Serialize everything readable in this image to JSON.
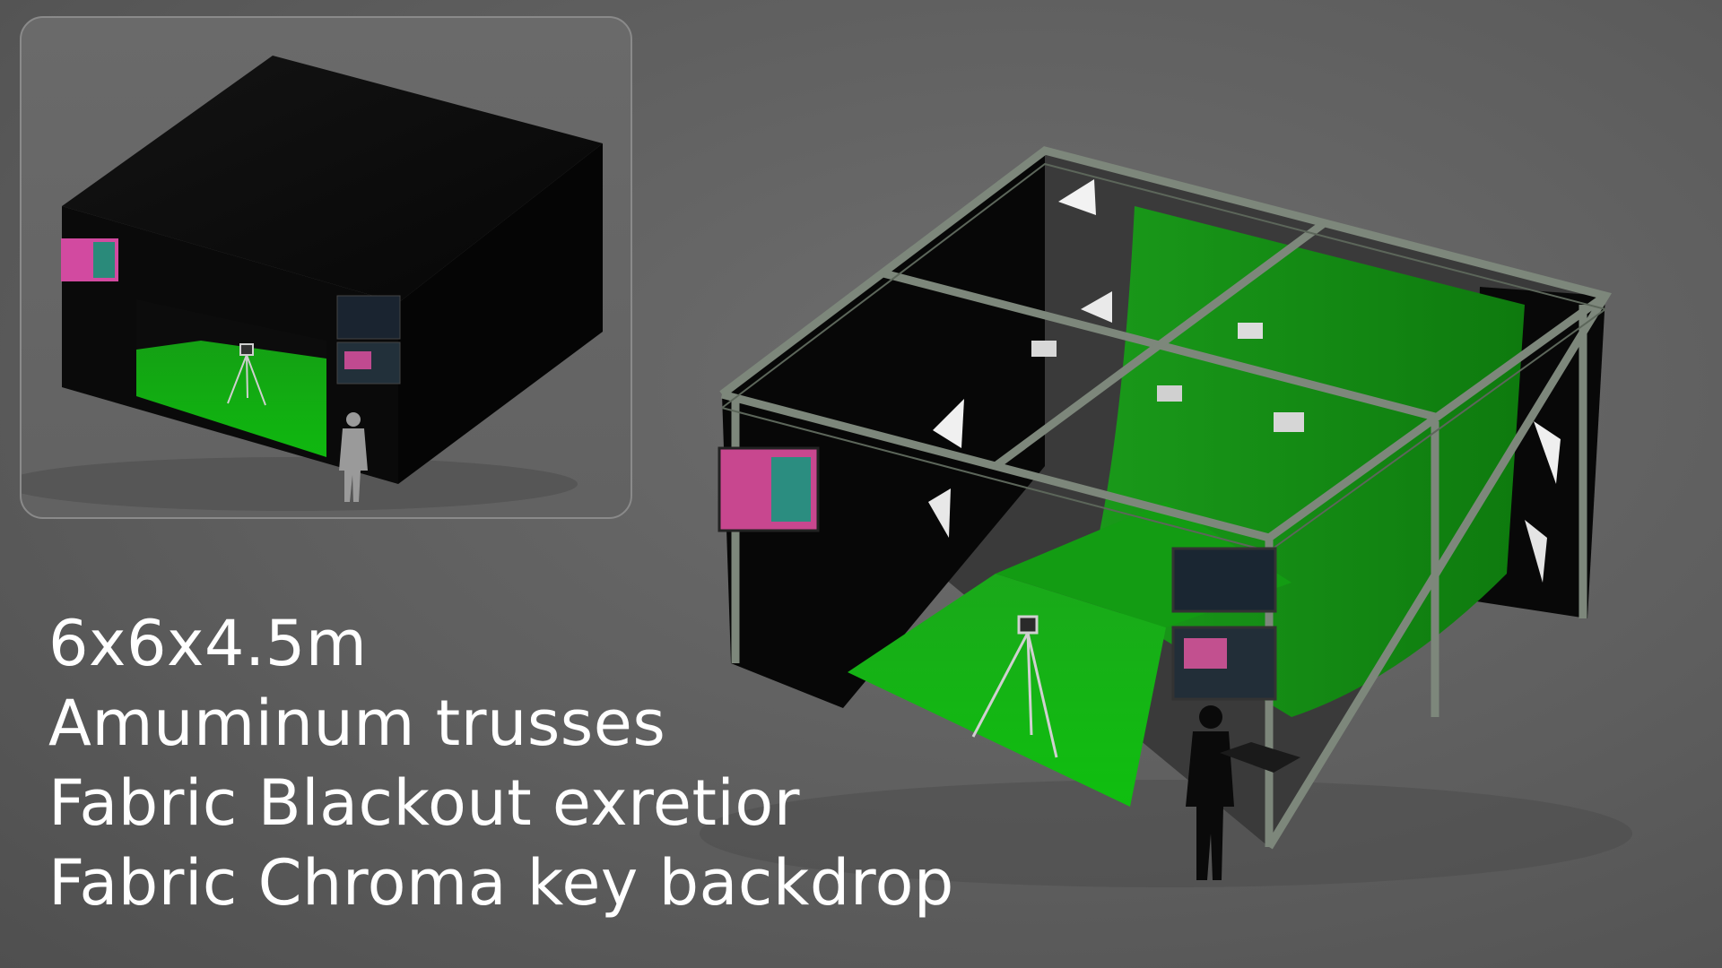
{
  "specs": {
    "line1": "6x6x4.5m",
    "line2": "Amuminum trusses",
    "line3": "Fabric Blackout exretior",
    "line4": "Fabric Chroma key backdrop"
  },
  "colors": {
    "background": "#5f5f5f",
    "chroma_green": "#1fa51f",
    "blackout": "#0b0b0b",
    "truss": "#7a8478",
    "text": "#ffffff"
  },
  "icons": [
    "person-silhouette",
    "camera-tripod",
    "monitor-screen",
    "softbox-light",
    "led-panel-light"
  ]
}
